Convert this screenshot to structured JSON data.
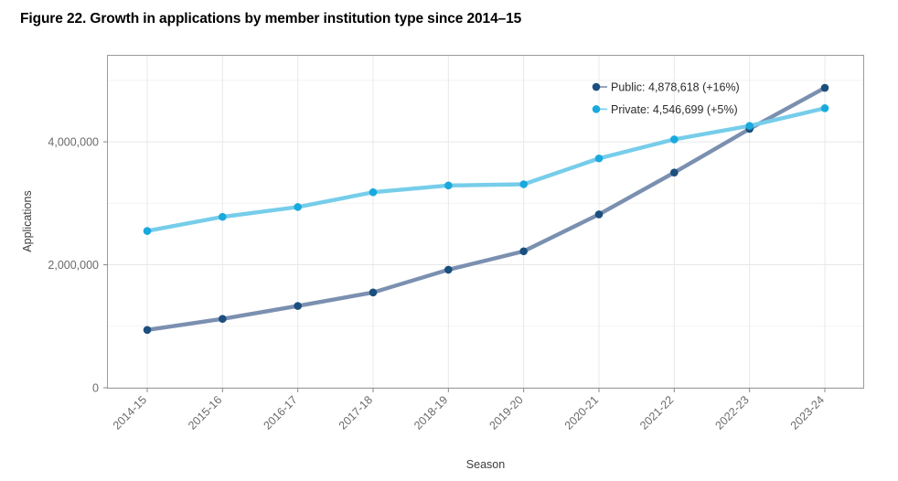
{
  "figure": {
    "title": "Figure 22. Growth in applications by member institution type since 2014–15"
  },
  "colors": {
    "public_line": "#7b90b0",
    "public_marker": "#1b4f7e",
    "private_line": "#76cdea",
    "private_marker": "#19a9dd",
    "gridline_major": "#e8e8e8",
    "gridline_minor": "#f3f3f3",
    "plot_border": "#9a9a9a",
    "text": "#3c3c3c"
  },
  "labels": {
    "public_endpoint": "Public: 4,878,618 (+16%)",
    "private_endpoint": "Private: 4,546,699 (+5%)"
  },
  "chart_data": {
    "type": "line",
    "title": "Figure 22. Growth in applications by member institution type since 2014–15",
    "xlabel": "Season",
    "ylabel": "Applications",
    "categories": [
      "2014-15",
      "2015-16",
      "2016-17",
      "2017-18",
      "2018-19",
      "2019-20",
      "2020-21",
      "2021-22",
      "2022-23",
      "2023-24"
    ],
    "ylim": [
      0,
      5400000
    ],
    "ytick_values": [
      0,
      2000000,
      4000000
    ],
    "ytick_labels": [
      "0",
      "2,000,000",
      "4,000,000"
    ],
    "yminor_values": [
      1000000,
      3000000,
      5000000
    ],
    "grid": true,
    "legend": "endpoint-labels",
    "series": [
      {
        "name": "Public",
        "color": "#7b90b0",
        "marker_color": "#1b4f7e",
        "values": [
          940000,
          1120000,
          1330000,
          1550000,
          1920000,
          2220000,
          2820000,
          3500000,
          4210000,
          4878618
        ],
        "end_label": "Public: 4,878,618 (+16%)"
      },
      {
        "name": "Private",
        "color": "#76cdea",
        "marker_color": "#19a9dd",
        "values": [
          2550000,
          2780000,
          2940000,
          3180000,
          3290000,
          3310000,
          3730000,
          4040000,
          4260000,
          4546699
        ],
        "end_label": "Private: 4,546,699 (+5%)"
      }
    ]
  }
}
